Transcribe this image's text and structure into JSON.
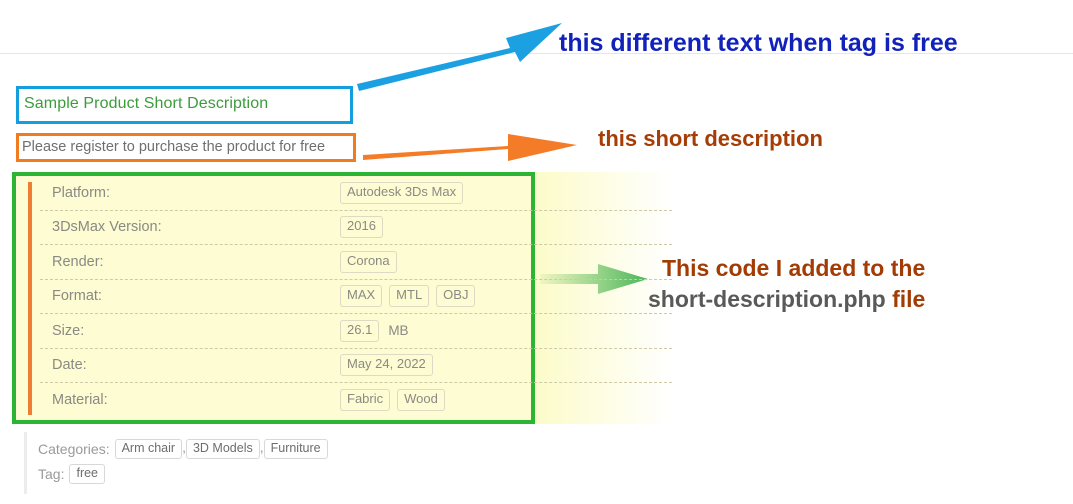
{
  "product": {
    "short_title": "Sample Product Short Description",
    "short_description": "Please register to purchase the product for free"
  },
  "specs": {
    "rows": [
      {
        "label": "Platform:",
        "values": [
          "Autodesk 3Ds Max"
        ],
        "unit": ""
      },
      {
        "label": "3DsMax Version:",
        "values": [
          "2016"
        ],
        "unit": ""
      },
      {
        "label": "Render:",
        "values": [
          "Corona"
        ],
        "unit": ""
      },
      {
        "label": "Format:",
        "values": [
          "MAX",
          "MTL",
          "OBJ"
        ],
        "unit": ""
      },
      {
        "label": "Size:",
        "values": [
          "26.1"
        ],
        "unit": "MB"
      },
      {
        "label": "Date:",
        "values": [
          "May 24, 2022"
        ],
        "unit": ""
      },
      {
        "label": "Material:",
        "values": [
          "Fabric",
          "Wood"
        ],
        "unit": ""
      }
    ]
  },
  "taxonomy": {
    "categories_label": "Categories:",
    "categories": [
      "Arm chair",
      "3D Models",
      "Furniture"
    ],
    "separator": ",",
    "tag_label": "Tag:",
    "tags": [
      "free"
    ]
  },
  "annotations": {
    "blue": "this different text when tag is free",
    "orange": "this short description",
    "green_line1": "This code I added to the",
    "green_line2_code": "short-description.php",
    "green_line2_tail": "file"
  },
  "colors": {
    "highlight_blue": "#139fde",
    "highlight_orange": "#f07c20",
    "highlight_green": "#2cb534",
    "annotation_blue": "#1122bb",
    "annotation_brown": "#a33c04",
    "glow_yellow": "#fcfbc8",
    "title_green": "#3c9c3c",
    "accent_orange": "#ef7e32"
  }
}
